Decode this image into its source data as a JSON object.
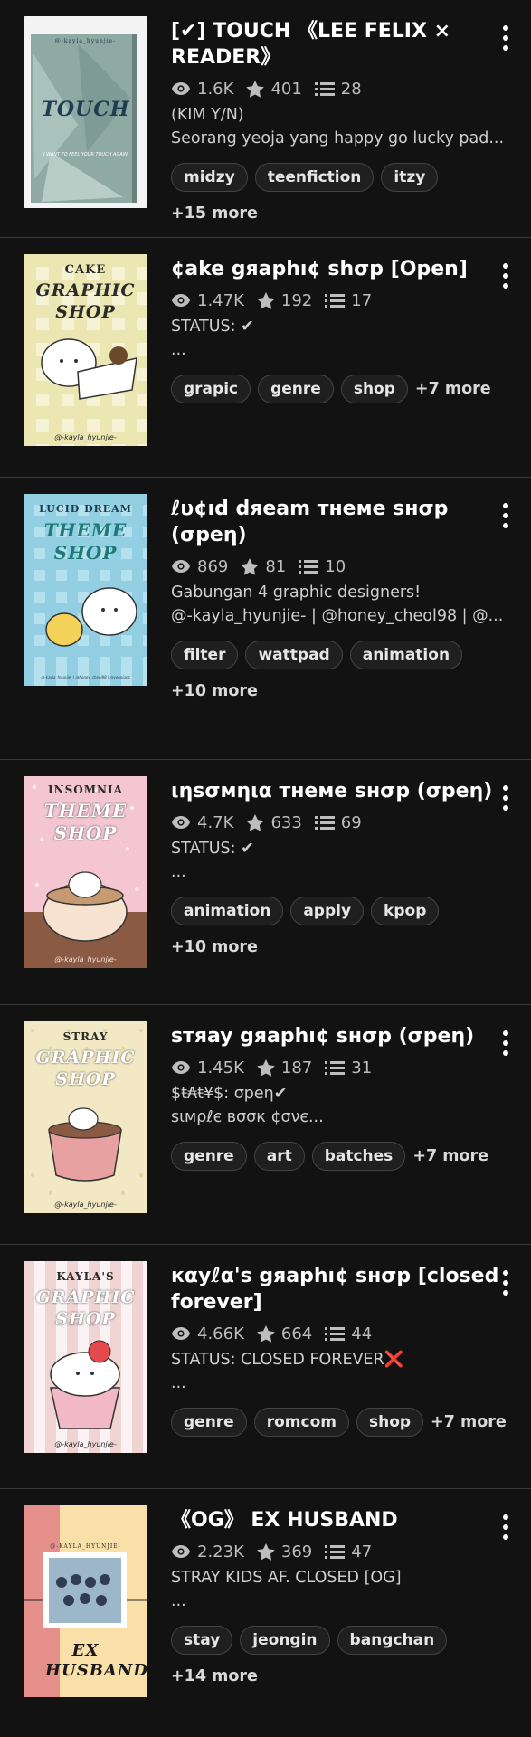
{
  "stories": [
    {
      "title": "[✔] TOUCH 《LEE FELIX × READER》",
      "views": "1.6K",
      "votes": "401",
      "parts": "28",
      "desc1": "(KIM Y/N)",
      "desc2": "Seorang yeoja yang happy go lucky pad...",
      "tags": [
        "midzy",
        "teenfiction",
        "itzy"
      ],
      "more": "+15 more",
      "cover": {
        "sup": "@-kayla_hyunjie-",
        "title": "TOUCH",
        "foot": "I WANT TO FEEL YOUR TOUCH AGAIN",
        "bg": "#8fa9a3",
        "accent": "#1f3d52"
      }
    },
    {
      "title": "¢ake gяaphı¢ shσp [Open]",
      "views": "1.47K",
      "votes": "192",
      "parts": "17",
      "desc1": "STATUS: ✔",
      "desc2": "...",
      "tags": [
        "grapic",
        "genre",
        "shop"
      ],
      "more": "+7 more",
      "cover": {
        "sup": "CAKE",
        "title": "GRAPHIC SHOP",
        "foot": "@-kayla_hyunjie-",
        "bg": "#f2eecb",
        "accent": "#2a2a2a"
      }
    },
    {
      "title": "ℓυ¢ıd dяeam тнeмe sнσp (σpeη)",
      "views": "869",
      "votes": "81",
      "parts": "10",
      "desc1": "Gabungan 4 graphic designers!",
      "desc2": "@-kayla_hyunjie- | @honey_cheol98 | @...",
      "tags": [
        "filter",
        "wattpad",
        "animation"
      ],
      "more": "+10 more",
      "cover": {
        "sup": "LUCID DREAM",
        "title": "THEME SHOP",
        "foot": "@-kayla_hyunjie- | @honey_cheol98 | @yeonjunz",
        "bg": "#9fd3e6",
        "accent": "#1e7a78"
      }
    },
    {
      "title": "ιηsσмηια тнeмe sнσp (σpeη)",
      "views": "4.7K",
      "votes": "633",
      "parts": "69",
      "desc1": "STATUS: ✔",
      "desc2": "...",
      "tags": [
        "animation",
        "apply",
        "kpop"
      ],
      "more": "+10 more",
      "cover": {
        "sup": "INSOMNIA",
        "title": "THEME SHOP",
        "foot": "@-kayla_hyunjie-",
        "bg": "#efbfcc",
        "accent": "#2a2a2a"
      }
    },
    {
      "title": "sтяay gяaphı¢ sнσp (σpeη)",
      "views": "1.45K",
      "votes": "187",
      "parts": "31",
      "desc1": "$ŧ₳ŧ¥$: σpeη✔",
      "desc2": "ѕιмρℓє вσσк ¢σνє...",
      "tags": [
        "genre",
        "art",
        "batches"
      ],
      "more": "+7 more",
      "cover": {
        "sup": "STRAY",
        "title": "GRAPHIC SHOP",
        "foot": "@-kayla_hyunjie-",
        "bg": "#f1e4bd",
        "accent": "#2a2a2a"
      }
    },
    {
      "title": "кαуℓα's gяaphı¢ sнσp [closed forever]",
      "views": "4.66K",
      "votes": "664",
      "parts": "44",
      "desc1": "STATUS: CLOSED FOREVER",
      "desc1_mark": "❌",
      "desc2": "...",
      "tags": [
        "genre",
        "romcom",
        "shop"
      ],
      "more": "+7 more",
      "cover": {
        "sup": "KAYLA'S",
        "title": "GRAPHIC SHOP",
        "foot": "@-kayla_hyunjie-",
        "bg": "#f6eaea",
        "accent": "#2a2a2a"
      }
    },
    {
      "title": "《OG》 EX HUSBAND",
      "views": "2.23K",
      "votes": "369",
      "parts": "47",
      "desc1": "STRAY KIDS AF. CLOSED [OG]",
      "desc2": "...",
      "tags": [
        "stay",
        "jeongin",
        "bangchan"
      ],
      "more": "+14 more",
      "cover": {
        "sup": "@-KAYLA_HYUNJIE-",
        "title": "EX HUSBAND",
        "foot": "",
        "bg": "#f7dda4",
        "accent": "#e6908c"
      }
    }
  ]
}
